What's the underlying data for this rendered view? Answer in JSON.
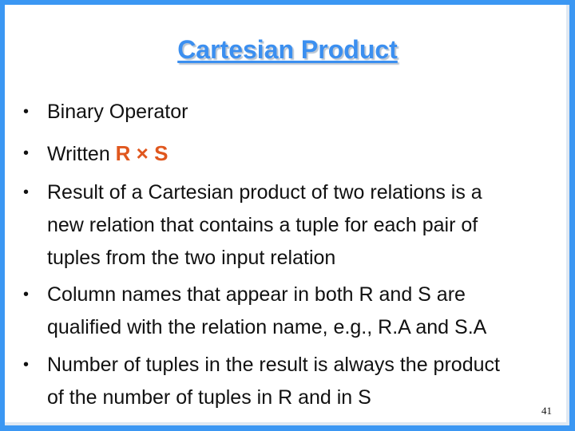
{
  "slide": {
    "title": "Cartesian Product",
    "bullets": [
      {
        "lines": [
          "Binary Operator"
        ]
      },
      {
        "prefix": "Written ",
        "expression": "R × S"
      },
      {
        "lines": [
          "Result of a Cartesian product of two relations is a",
          "new relation that contains a tuple for each pair of",
          "tuples from the two input relation"
        ]
      },
      {
        "lines": [
          "Column names that appear in both R and S are",
          "qualified with the relation name, e.g., R.A and S.A"
        ]
      },
      {
        "lines": [
          "Number of tuples in the result is always the product",
          "of the number of tuples in R and in S"
        ]
      }
    ],
    "bullet_glyph": "•",
    "page_number": "41",
    "colors": {
      "frame": "#3b97f3",
      "title": "#3b8ff0",
      "expression": "#e0571e",
      "text": "#111111"
    }
  }
}
